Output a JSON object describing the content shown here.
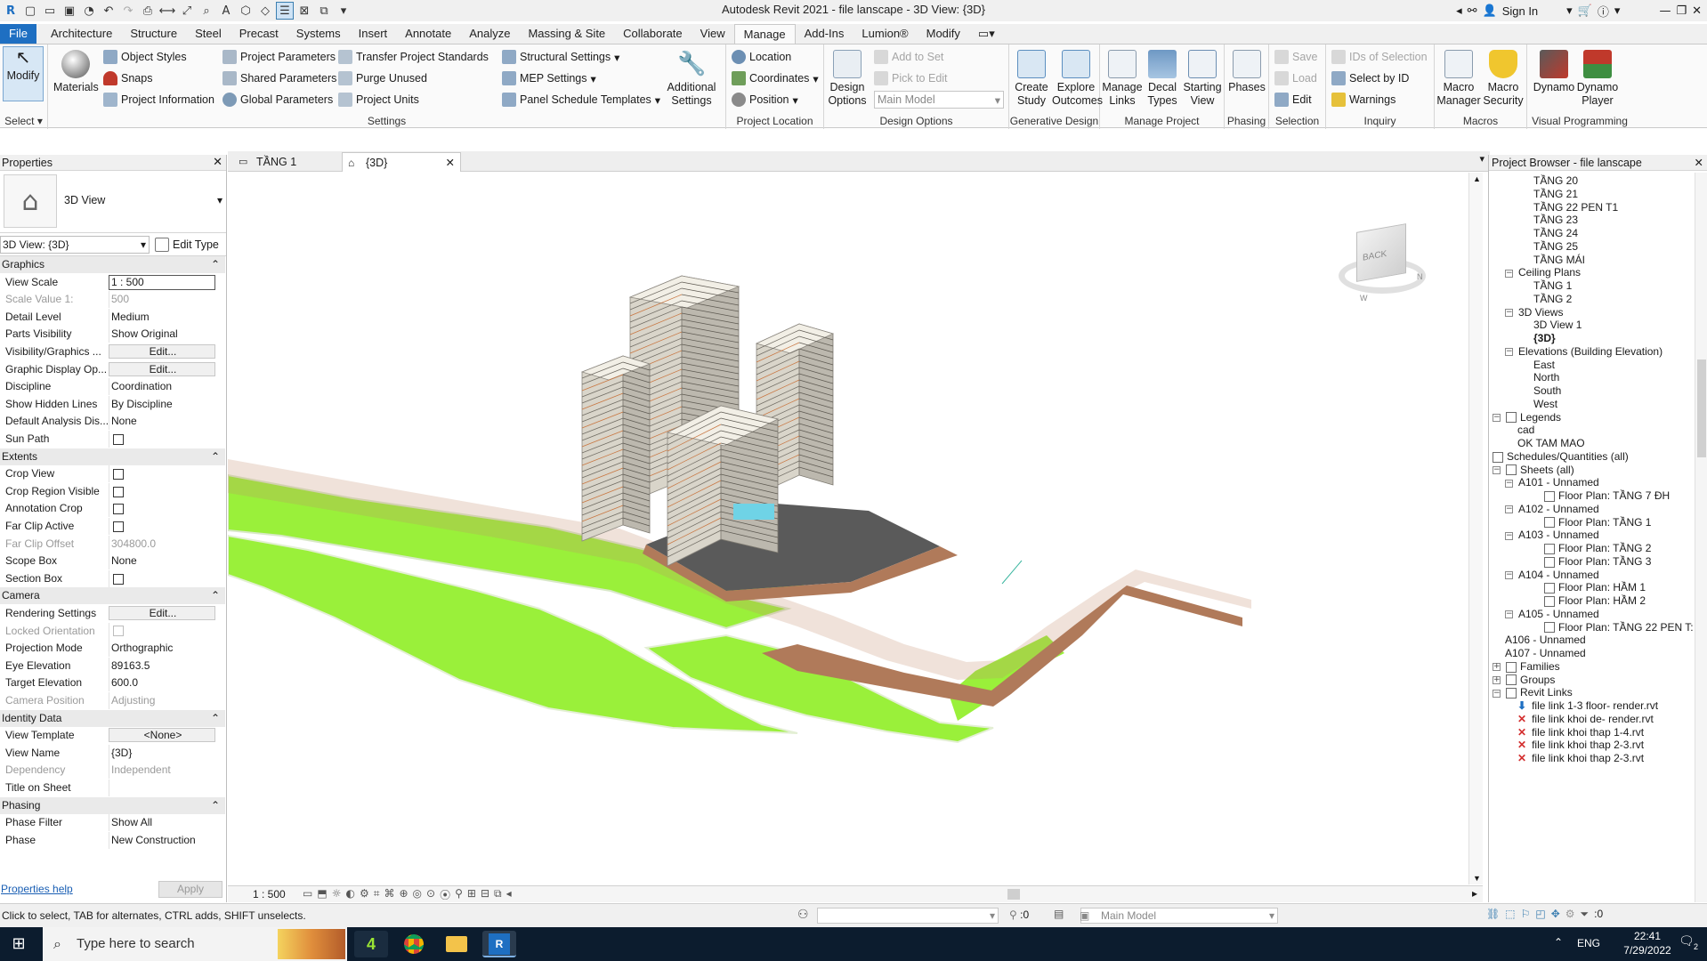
{
  "window": {
    "title": "Autodesk Revit 2021 - file lanscape - 3D View: {3D}",
    "sign_in": "Sign In"
  },
  "ribbon_tabs": [
    "File",
    "Architecture",
    "Structure",
    "Steel",
    "Precast",
    "Systems",
    "Insert",
    "Annotate",
    "Analyze",
    "Massing & Site",
    "Collaborate",
    "View",
    "Manage",
    "Add-Ins",
    "Lumion®",
    "Modify"
  ],
  "ribbon": {
    "select_label": "Select",
    "modify": "Modify",
    "materials": "Materials",
    "object_styles": "Object Styles",
    "snaps": "Snaps",
    "project_information": "Project Information",
    "project_parameters": "Project Parameters",
    "shared_parameters": "Shared Parameters",
    "global_parameters": "Global Parameters",
    "transfer_project_standards": "Transfer Project Standards",
    "purge_unused": "Purge Unused",
    "project_units": "Project Units",
    "structural_settings": "Structural Settings",
    "mep_settings": "MEP Settings",
    "panel_schedule_templates": "Panel Schedule Templates",
    "additional_settings": "Additional Settings",
    "settings_label": "Settings",
    "location": "Location",
    "coordinates": "Coordinates",
    "position": "Position",
    "project_location_label": "Project Location",
    "design_options": "Design Options",
    "add_to_set": "Add to Set",
    "pick_to_edit": "Pick to Edit",
    "main_model": "Main Model",
    "design_options_label": "Design Options",
    "create_study": "Create Study",
    "explore_outcomes": "Explore Outcomes",
    "generative_design_label": "Generative Design",
    "manage_links": "Manage Links",
    "decal_types": "Decal Types",
    "starting_view": "Starting View",
    "manage_project_label": "Manage Project",
    "phases": "Phases",
    "phasing_label": "Phasing",
    "save": "Save",
    "load": "Load",
    "edit": "Edit",
    "selection_label": "Selection",
    "ids_of_selection": "IDs of Selection",
    "select_by_id": "Select by ID",
    "warnings": "Warnings",
    "inquiry_label": "Inquiry",
    "macro_manager": "Macro Manager",
    "macro_security": "Macro Security",
    "macros_label": "Macros",
    "dynamo": "Dynamo",
    "dynamo_player": "Dynamo Player",
    "visual_programming_label": "Visual Programming"
  },
  "view_tabs": [
    {
      "label": "TẦNG 1"
    },
    {
      "label": "{3D}"
    }
  ],
  "properties": {
    "title": "Properties",
    "type_name": "3D View",
    "selector": "3D View: {3D}",
    "edit_type": "Edit Type",
    "help": "Properties help",
    "apply": "Apply",
    "rows": [
      {
        "section": "Graphics"
      },
      {
        "k": "View Scale",
        "v": "1 : 500",
        "kind": "input"
      },
      {
        "k": "Scale Value    1:",
        "v": "500",
        "dim": true
      },
      {
        "k": "Detail Level",
        "v": "Medium"
      },
      {
        "k": "Parts Visibility",
        "v": "Show Original"
      },
      {
        "k": "Visibility/Graphics ...",
        "v": "Edit...",
        "kind": "btn"
      },
      {
        "k": "Graphic Display Op...",
        "v": "Edit...",
        "kind": "btn"
      },
      {
        "k": "Discipline",
        "v": "Coordination"
      },
      {
        "k": "Show Hidden Lines",
        "v": "By Discipline"
      },
      {
        "k": "Default Analysis Dis...",
        "v": "None"
      },
      {
        "k": "Sun Path",
        "v": "",
        "kind": "cb"
      },
      {
        "section": "Extents"
      },
      {
        "k": "Crop View",
        "v": "",
        "kind": "cb"
      },
      {
        "k": "Crop Region Visible",
        "v": "",
        "kind": "cb"
      },
      {
        "k": "Annotation Crop",
        "v": "",
        "kind": "cb"
      },
      {
        "k": "Far Clip Active",
        "v": "",
        "kind": "cb"
      },
      {
        "k": "Far Clip Offset",
        "v": "304800.0",
        "dim": true
      },
      {
        "k": "Scope Box",
        "v": "None"
      },
      {
        "k": "Section Box",
        "v": "",
        "kind": "cb"
      },
      {
        "section": "Camera"
      },
      {
        "k": "Rendering Settings",
        "v": "Edit...",
        "kind": "btn"
      },
      {
        "k": "Locked Orientation",
        "v": "",
        "kind": "cb",
        "dim": true
      },
      {
        "k": "Projection Mode",
        "v": "Orthographic"
      },
      {
        "k": "Eye Elevation",
        "v": "89163.5"
      },
      {
        "k": "Target Elevation",
        "v": "600.0"
      },
      {
        "k": "Camera Position",
        "v": "Adjusting",
        "dim": true
      },
      {
        "section": "Identity Data"
      },
      {
        "k": "View Template",
        "v": "<None>",
        "kind": "btn"
      },
      {
        "k": "View Name",
        "v": "{3D}"
      },
      {
        "k": "Dependency",
        "v": "Independent",
        "dim": true
      },
      {
        "k": "Title on Sheet",
        "v": ""
      },
      {
        "section": "Phasing"
      },
      {
        "k": "Phase Filter",
        "v": "Show All"
      },
      {
        "k": "Phase",
        "v": "New Construction"
      }
    ]
  },
  "viewcube": {
    "face": "BACK",
    "n": "N",
    "w": "W"
  },
  "view_control_bar": {
    "scale": "1 : 500"
  },
  "project_browser": {
    "title": "Project Browser - file lanscape",
    "items": [
      {
        "label": "TẦNG 20",
        "lvl": 3
      },
      {
        "label": "TẦNG 21",
        "lvl": 3
      },
      {
        "label": "TẦNG 22 PEN T1",
        "lvl": 3
      },
      {
        "label": "TẦNG 23",
        "lvl": 3
      },
      {
        "label": "TẦNG 24",
        "lvl": 3
      },
      {
        "label": "TẦNG 25",
        "lvl": 3
      },
      {
        "label": "TẦNG MÁI",
        "lvl": 3
      },
      {
        "label": "Ceiling Plans",
        "lvl": 2,
        "exp": "−"
      },
      {
        "label": "TẦNG 1",
        "lvl": 3
      },
      {
        "label": "TẦNG 2",
        "lvl": 3
      },
      {
        "label": "3D Views",
        "lvl": 2,
        "exp": "−"
      },
      {
        "label": "3D View 1",
        "lvl": 3
      },
      {
        "label": "{3D}",
        "lvl": 3,
        "bold": true
      },
      {
        "label": "Elevations (Building Elevation)",
        "lvl": 2,
        "exp": "−"
      },
      {
        "label": "East",
        "lvl": 3
      },
      {
        "label": "North",
        "lvl": 3
      },
      {
        "label": "South",
        "lvl": 3
      },
      {
        "label": "West",
        "lvl": 3
      },
      {
        "label": "Legends",
        "lvl": 0,
        "exp": "−",
        "icon": true
      },
      {
        "label": "cad",
        "lvl": 1
      },
      {
        "label": "OK TAM MAO",
        "lvl": 1
      },
      {
        "label": "Schedules/Quantities (all)",
        "lvl": 0,
        "icon": true
      },
      {
        "label": "Sheets (all)",
        "lvl": 0,
        "exp": "−",
        "icon": true
      },
      {
        "label": "A101 - Unnamed",
        "lvl": 2,
        "exp": "−"
      },
      {
        "label": "Floor Plan: TẦNG 7 ĐH",
        "lvl": 4,
        "icon": true
      },
      {
        "label": "A102 - Unnamed",
        "lvl": 2,
        "exp": "−"
      },
      {
        "label": "Floor Plan: TẦNG 1",
        "lvl": 4,
        "icon": true
      },
      {
        "label": "A103 - Unnamed",
        "lvl": 2,
        "exp": "−"
      },
      {
        "label": "Floor Plan: TẦNG 2",
        "lvl": 4,
        "icon": true
      },
      {
        "label": "Floor Plan: TẦNG 3",
        "lvl": 4,
        "icon": true
      },
      {
        "label": "A104 - Unnamed",
        "lvl": 2,
        "exp": "−"
      },
      {
        "label": "Floor Plan: HẦM 1",
        "lvl": 4,
        "icon": true
      },
      {
        "label": "Floor Plan: HẦM 2",
        "lvl": 4,
        "icon": true
      },
      {
        "label": "A105 - Unnamed",
        "lvl": 2,
        "exp": "−"
      },
      {
        "label": "Floor Plan: TẦNG 22 PEN T:",
        "lvl": 4,
        "icon": true
      },
      {
        "label": "A106 - Unnamed",
        "lvl": 2
      },
      {
        "label": "A107 - Unnamed",
        "lvl": 2
      },
      {
        "label": "Families",
        "lvl": 0,
        "exp": "+",
        "icon": true
      },
      {
        "label": "Groups",
        "lvl": 0,
        "exp": "+",
        "icon": true
      },
      {
        "label": "Revit Links",
        "lvl": 0,
        "exp": "−",
        "icon": true
      },
      {
        "label": "file link 1-3 floor- render.rvt",
        "lvl": 1,
        "mark": "ok"
      },
      {
        "label": "file link khoi de- render.rvt",
        "lvl": 1,
        "mark": "x"
      },
      {
        "label": "file link khoi thap 1-4.rvt",
        "lvl": 1,
        "mark": "x"
      },
      {
        "label": "file link khoi thap 2-3.rvt",
        "lvl": 1,
        "mark": "x"
      },
      {
        "label": "file link khoi thap 2-3.rvt",
        "lvl": 1,
        "mark": "x"
      }
    ]
  },
  "status": {
    "message": "Click to select, TAB for alternates, CTRL adds, SHIFT unselects.",
    "count": ":0",
    "model": "Main Model",
    "filter_count": ":0"
  },
  "taskbar": {
    "search_placeholder": "Type here to search",
    "lang": "ENG",
    "time": "22:41",
    "date": "7/29/2022",
    "notif_count": "2"
  },
  "colors": {
    "accent": "#1e6fc2",
    "grass": "#9af03a",
    "path": "#b07a5a"
  }
}
